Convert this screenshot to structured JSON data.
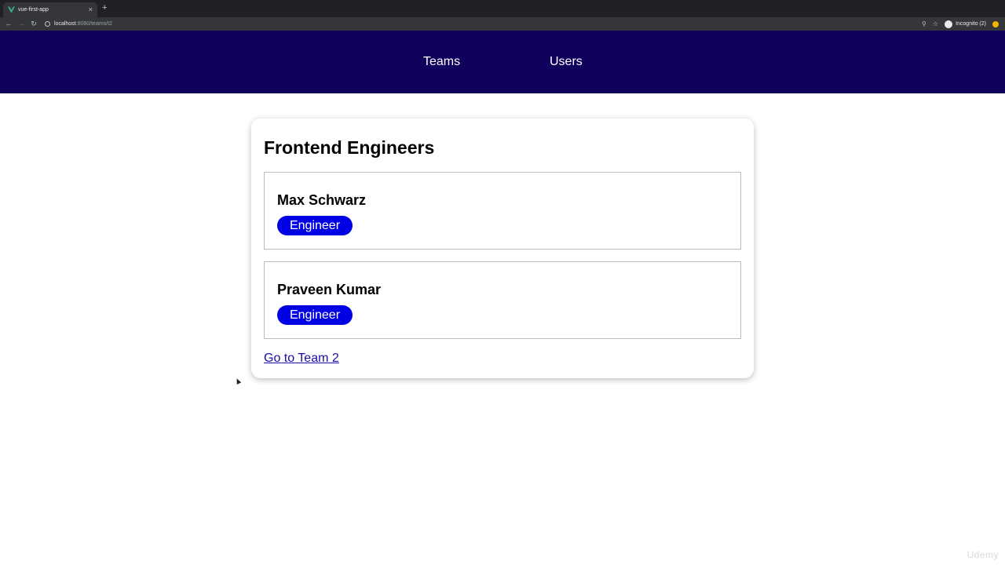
{
  "browser": {
    "tab_title": "vue-first-app",
    "tab_close": "×",
    "new_tab": "+",
    "url_host": "localhost",
    "url_path": ":8080/teams/t2",
    "incognito_label": "Incognito (2)"
  },
  "nav": {
    "teams": "Teams",
    "users": "Users"
  },
  "team": {
    "title": "Frontend Engineers",
    "members": [
      {
        "name": "Max Schwarz",
        "role": "Engineer"
      },
      {
        "name": "Praveen Kumar",
        "role": "Engineer"
      }
    ],
    "link_label": "Go to Team 2"
  },
  "watermark": "Udemy",
  "colors": {
    "header_bg": "#11005c",
    "badge_bg": "#0000e4",
    "link": "#1a0dab"
  }
}
